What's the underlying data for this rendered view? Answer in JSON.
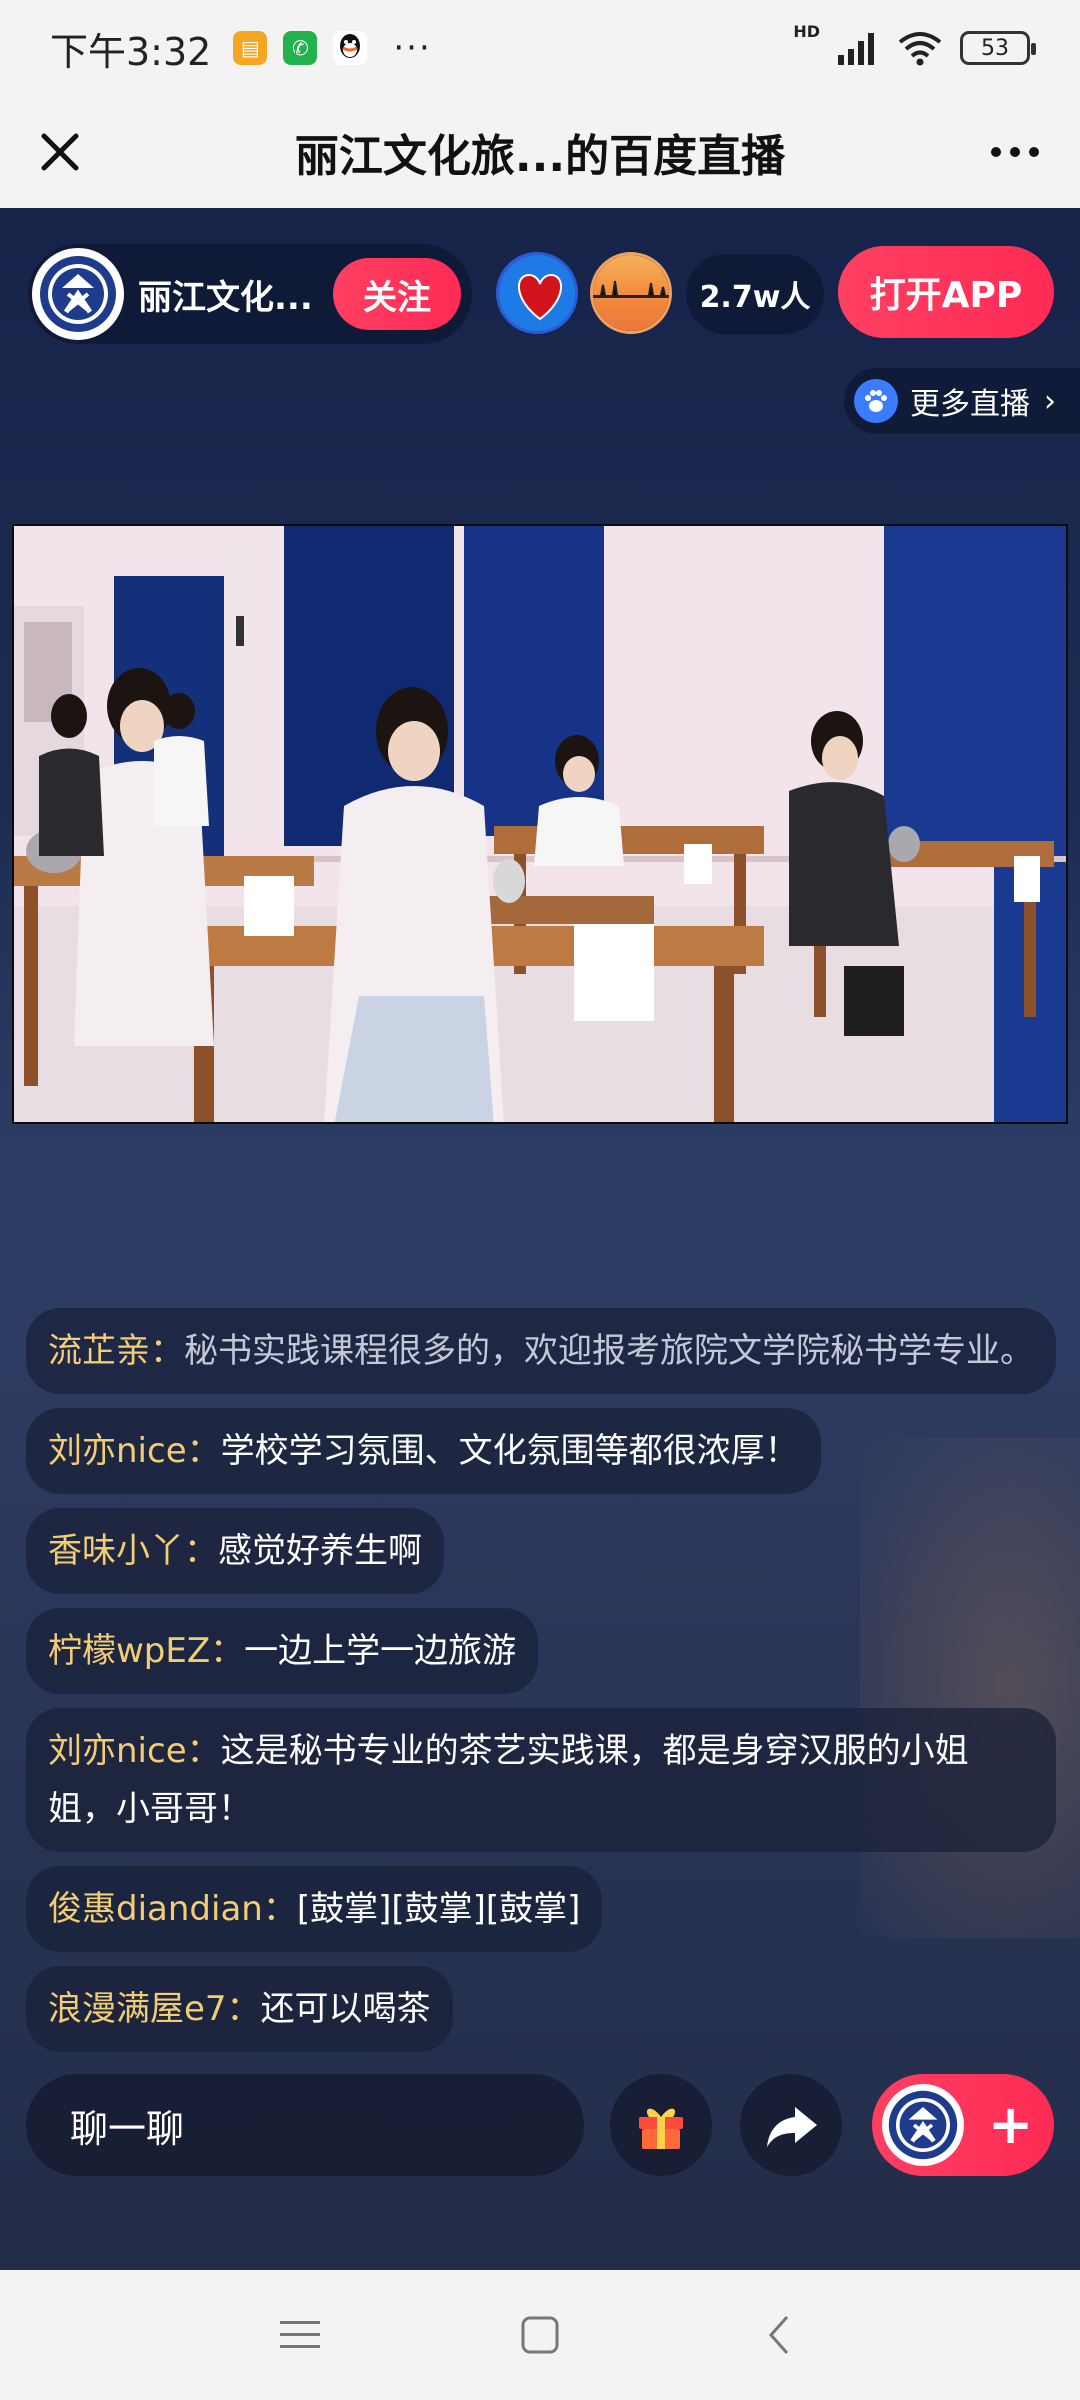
{
  "status_bar": {
    "time": "下午3:32",
    "dots": "···",
    "network": "HD",
    "battery": "53"
  },
  "title_bar": {
    "title": "丽江文化旅...的百度直播"
  },
  "live": {
    "host_name": "丽江文化...",
    "follow_label": "关注",
    "viewer_count": "2.7w人",
    "open_app_label": "打开APP",
    "more_live_label": "更多直播"
  },
  "chat": [
    {
      "user": "流芷亲：",
      "text": "秘书实践课程很多的，欢迎报考旅院文学院秘书学专业。"
    },
    {
      "user": "刘亦nice：",
      "text": "学校学习氛围、文化氛围等都很浓厚！"
    },
    {
      "user": "香味小丫：",
      "text": "感觉好养生啊"
    },
    {
      "user": "柠檬wpEZ：",
      "text": "一边上学一边旅游"
    },
    {
      "user": "刘亦nice：",
      "text": "这是秘书专业的茶艺实践课，都是身穿汉服的小姐姐，小哥哥！"
    },
    {
      "user": "俊惠diandian：",
      "text": "[鼓掌][鼓掌][鼓掌]"
    },
    {
      "user": "浪漫满屋e7：",
      "text": "还可以喝茶"
    }
  ],
  "bottom": {
    "chat_placeholder": "聊一聊",
    "plus_label": "+"
  },
  "colors": {
    "accent": "#ff2b55",
    "username": "#f2cd73",
    "background": "#1d2b52"
  }
}
